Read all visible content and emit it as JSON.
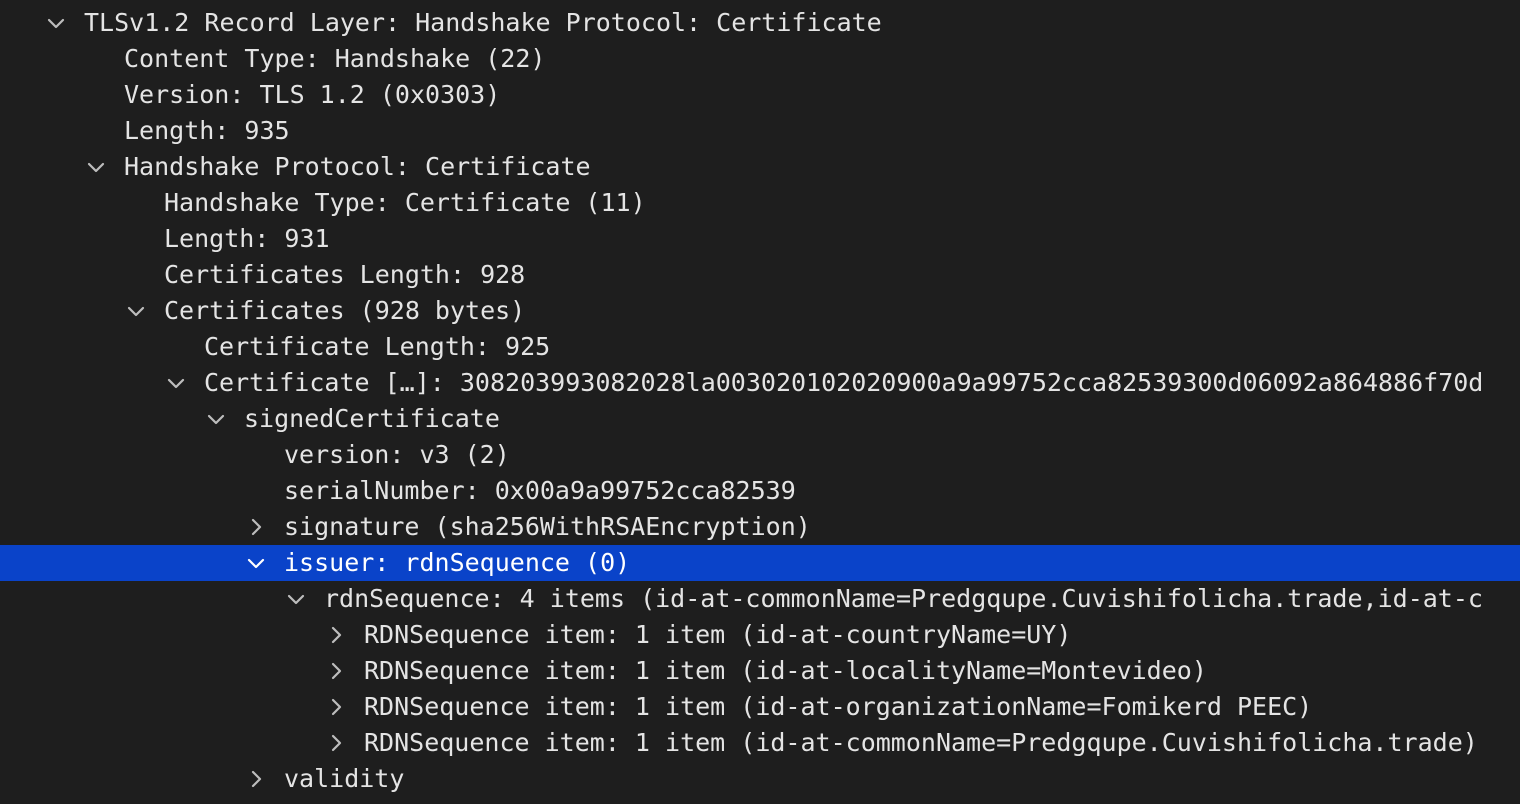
{
  "rows": [
    {
      "depth": 0,
      "twisty": "expanded",
      "selected": false,
      "text": "TLSv1.2 Record Layer: Handshake Protocol: Certificate"
    },
    {
      "depth": 1,
      "twisty": "none",
      "selected": false,
      "text": "Content Type: Handshake (22)"
    },
    {
      "depth": 1,
      "twisty": "none",
      "selected": false,
      "text": "Version: TLS 1.2 (0x0303)"
    },
    {
      "depth": 1,
      "twisty": "none",
      "selected": false,
      "text": "Length: 935"
    },
    {
      "depth": 1,
      "twisty": "expanded",
      "selected": false,
      "text": "Handshake Protocol: Certificate"
    },
    {
      "depth": 2,
      "twisty": "none",
      "selected": false,
      "text": "Handshake Type: Certificate (11)"
    },
    {
      "depth": 2,
      "twisty": "none",
      "selected": false,
      "text": "Length: 931"
    },
    {
      "depth": 2,
      "twisty": "none",
      "selected": false,
      "text": "Certificates Length: 928"
    },
    {
      "depth": 2,
      "twisty": "expanded",
      "selected": false,
      "text": "Certificates (928 bytes)"
    },
    {
      "depth": 3,
      "twisty": "none",
      "selected": false,
      "text": "Certificate Length: 925"
    },
    {
      "depth": 3,
      "twisty": "expanded",
      "selected": false,
      "text": "Certificate […]: 308203993082028la003020102020900a9a99752cca82539300d06092a864886f70d"
    },
    {
      "depth": 4,
      "twisty": "expanded",
      "selected": false,
      "text": "signedCertificate"
    },
    {
      "depth": 5,
      "twisty": "none",
      "selected": false,
      "text": "version: v3 (2)"
    },
    {
      "depth": 5,
      "twisty": "none",
      "selected": false,
      "text": "serialNumber: 0x00a9a99752cca82539"
    },
    {
      "depth": 5,
      "twisty": "collapsed",
      "selected": false,
      "text": "signature (sha256WithRSAEncryption)"
    },
    {
      "depth": 5,
      "twisty": "expanded",
      "selected": true,
      "text": "issuer: rdnSequence (0)"
    },
    {
      "depth": 6,
      "twisty": "expanded",
      "selected": false,
      "text": "rdnSequence: 4 items (id-at-commonName=Predgqupe.Cuvishifolicha.trade,id-at-c"
    },
    {
      "depth": 7,
      "twisty": "collapsed",
      "selected": false,
      "text": "RDNSequence item: 1 item (id-at-countryName=UY)"
    },
    {
      "depth": 7,
      "twisty": "collapsed",
      "selected": false,
      "text": "RDNSequence item: 1 item (id-at-localityName=Montevideo)"
    },
    {
      "depth": 7,
      "twisty": "collapsed",
      "selected": false,
      "text": "RDNSequence item: 1 item (id-at-organizationName=Fomikerd PEEC)"
    },
    {
      "depth": 7,
      "twisty": "collapsed",
      "selected": false,
      "text": "RDNSequence item: 1 item (id-at-commonName=Predgqupe.Cuvishifolicha.trade)"
    },
    {
      "depth": 5,
      "twisty": "collapsed",
      "selected": false,
      "text": "validity"
    }
  ],
  "colors": {
    "background": "#1e1e1e",
    "text": "#e4e4e4",
    "selection": "#0a43c9",
    "selected_text": "#ffffff",
    "twisty": "#bdbdbd"
  }
}
